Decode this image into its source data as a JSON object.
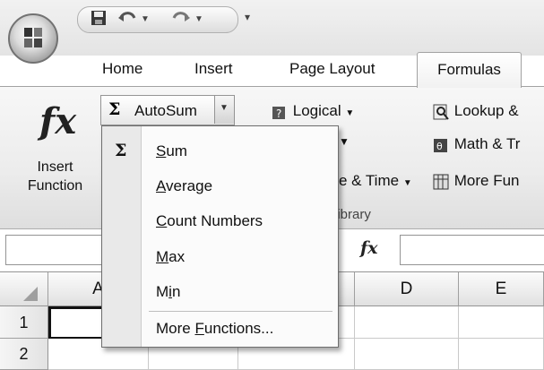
{
  "quick_access": {
    "save_icon": "save-icon",
    "undo_icon": "undo-icon",
    "redo_icon": "redo-icon",
    "customize_icon": "customize-qat-icon"
  },
  "tabs": [
    {
      "label": "Home"
    },
    {
      "label": "Insert"
    },
    {
      "label": "Page Layout"
    },
    {
      "label": "Formulas",
      "active": true
    }
  ],
  "ribbon": {
    "insert_function": {
      "line1": "Insert",
      "line2": "Function"
    },
    "autosum": {
      "label": "AutoSum"
    },
    "logical": {
      "label": "Logical"
    },
    "lookup": {
      "label": "Lookup &"
    },
    "math": {
      "label": "Math & Tr"
    },
    "date_time": {
      "label": "e & Time"
    },
    "more_functions": {
      "label": "More Fun"
    },
    "group_label": "Library"
  },
  "formula_bar": {
    "fx_label": "fx"
  },
  "grid": {
    "columns": [
      "A",
      "D",
      "E"
    ],
    "rows": [
      "1",
      "2"
    ]
  },
  "menu": {
    "items": [
      {
        "label": "Sum",
        "underline": "S",
        "rest": "um"
      },
      {
        "label": "Average",
        "underline": "A",
        "rest": "verage"
      },
      {
        "label": "Count Numbers",
        "underline": "C",
        "rest": "ount Numbers"
      },
      {
        "label": "Max",
        "underline": "M",
        "rest": "ax"
      },
      {
        "label": "Min",
        "pre": "M",
        "underline": "i",
        "rest": "n"
      },
      {
        "label": "More Functions...",
        "pre": "More ",
        "underline": "F",
        "rest": "unctions..."
      }
    ]
  }
}
